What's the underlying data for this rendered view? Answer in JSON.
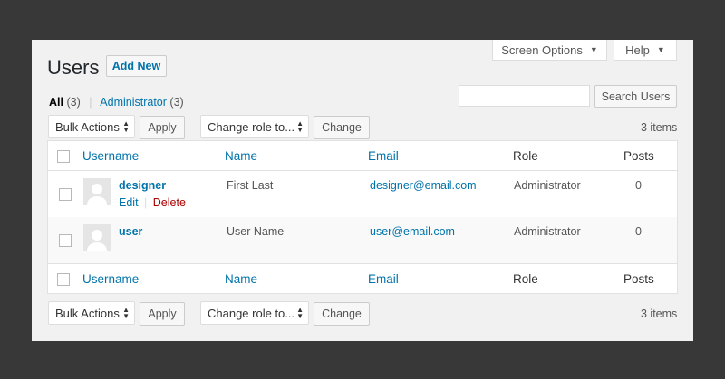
{
  "screen_options": {
    "label": "Screen Options"
  },
  "help": {
    "label": "Help"
  },
  "page": {
    "title": "Users",
    "add_new": "Add New"
  },
  "filters": {
    "all_label": "All",
    "all_count": "(3)",
    "separator": "|",
    "admin_label": "Administrator",
    "admin_count": "(3)"
  },
  "search": {
    "value": "",
    "button": "Search Users"
  },
  "top_nav": {
    "bulk_actions": "Bulk Actions",
    "apply": "Apply",
    "change_role": "Change role to...",
    "change": "Change",
    "items": "3 items"
  },
  "bottom_nav": {
    "bulk_actions": "Bulk Actions",
    "apply": "Apply",
    "change_role": "Change role to...",
    "change": "Change",
    "items": "3 items"
  },
  "table": {
    "columns": [
      "Username",
      "Name",
      "Email",
      "Role",
      "Posts"
    ],
    "rows": [
      {
        "username": "designer",
        "name": "First Last",
        "email": "designer@email.com",
        "role": "Administrator",
        "posts": "0",
        "edit": "Edit",
        "delete": "Delete"
      },
      {
        "username": "user",
        "name": "User Name",
        "email": "user@email.com",
        "role": "Administrator",
        "posts": "0"
      }
    ]
  },
  "colors": {
    "link": "#0073aa",
    "delete": "#a00",
    "background": "#383838",
    "panel": "#f1f1f1"
  }
}
